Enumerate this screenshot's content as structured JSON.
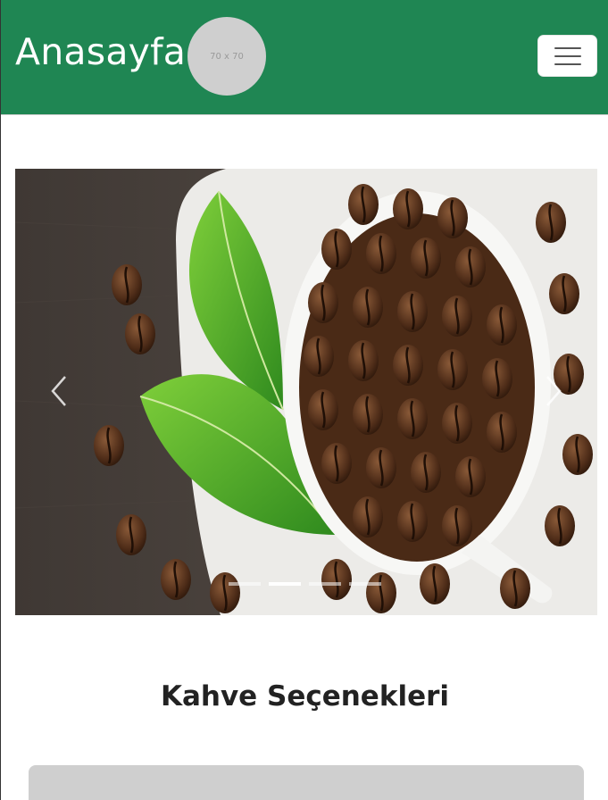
{
  "navbar": {
    "brand": "Anasayfa",
    "logo_placeholder": "70 x 70",
    "toggler_icon": "hamburger-menu-icon",
    "background": "#1f8653"
  },
  "carousel": {
    "image_alt": "Coffee beans in a white cup with green leaves",
    "prev_icon": "chevron-left-icon",
    "next_icon": "chevron-right-icon",
    "slide_count": 4,
    "active_index": 1
  },
  "main": {
    "section_title": "Kahve Seçenekleri"
  }
}
